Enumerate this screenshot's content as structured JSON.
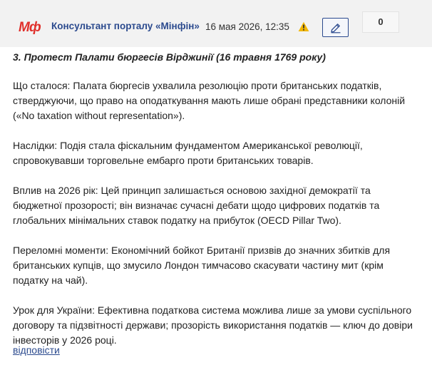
{
  "header": {
    "logo_text": "Мф",
    "author": "Консультант порталу «Мінфін»",
    "timestamp": "16 мая 2026, 12:35",
    "warn_icon": "warning-icon",
    "edit_icon": "pencil-icon",
    "score": "0"
  },
  "comment": {
    "title": "3. Протест Палати бюргесів Вірджинії (16 травня 1769 року)",
    "paragraphs": [
      "Що сталося: Палата бюргесів ухвалила резолюцію проти британських податків, стверджуючи, що право на оподаткування мають лише обрані представники колоній («No taxation without representation»).",
      "Наслідки: Подія стала фіскальним фундаментом Американської революції, спровокувавши торговельне ембарго проти британських товарів.",
      "Вплив на 2026 рік: Цей принцип залишається основою західної демократії та бюджетної прозорості; він визначає сучасні дебати щодо цифрових податків та глобальних мінімальних ставок податку на прибуток (OECD Pillar Two).",
      "Переломні моменти: Економічний бойкот Британії призвів до значних збитків для британських купців, що змусило Лондон тимчасово скасувати частину мит (крім податку на чай).",
      "Урок для України: Ефективна податкова система можлива лише за умови суспільного договору та підзвітності держави; прозорість використання податків — ключ до довіри інвесторів у 2026 році."
    ]
  },
  "footer": {
    "reply_label": "відповісти"
  },
  "colors": {
    "brand_red": "#e0302b",
    "link_blue": "#2b4a8e",
    "warning_yellow": "#f2b705"
  }
}
